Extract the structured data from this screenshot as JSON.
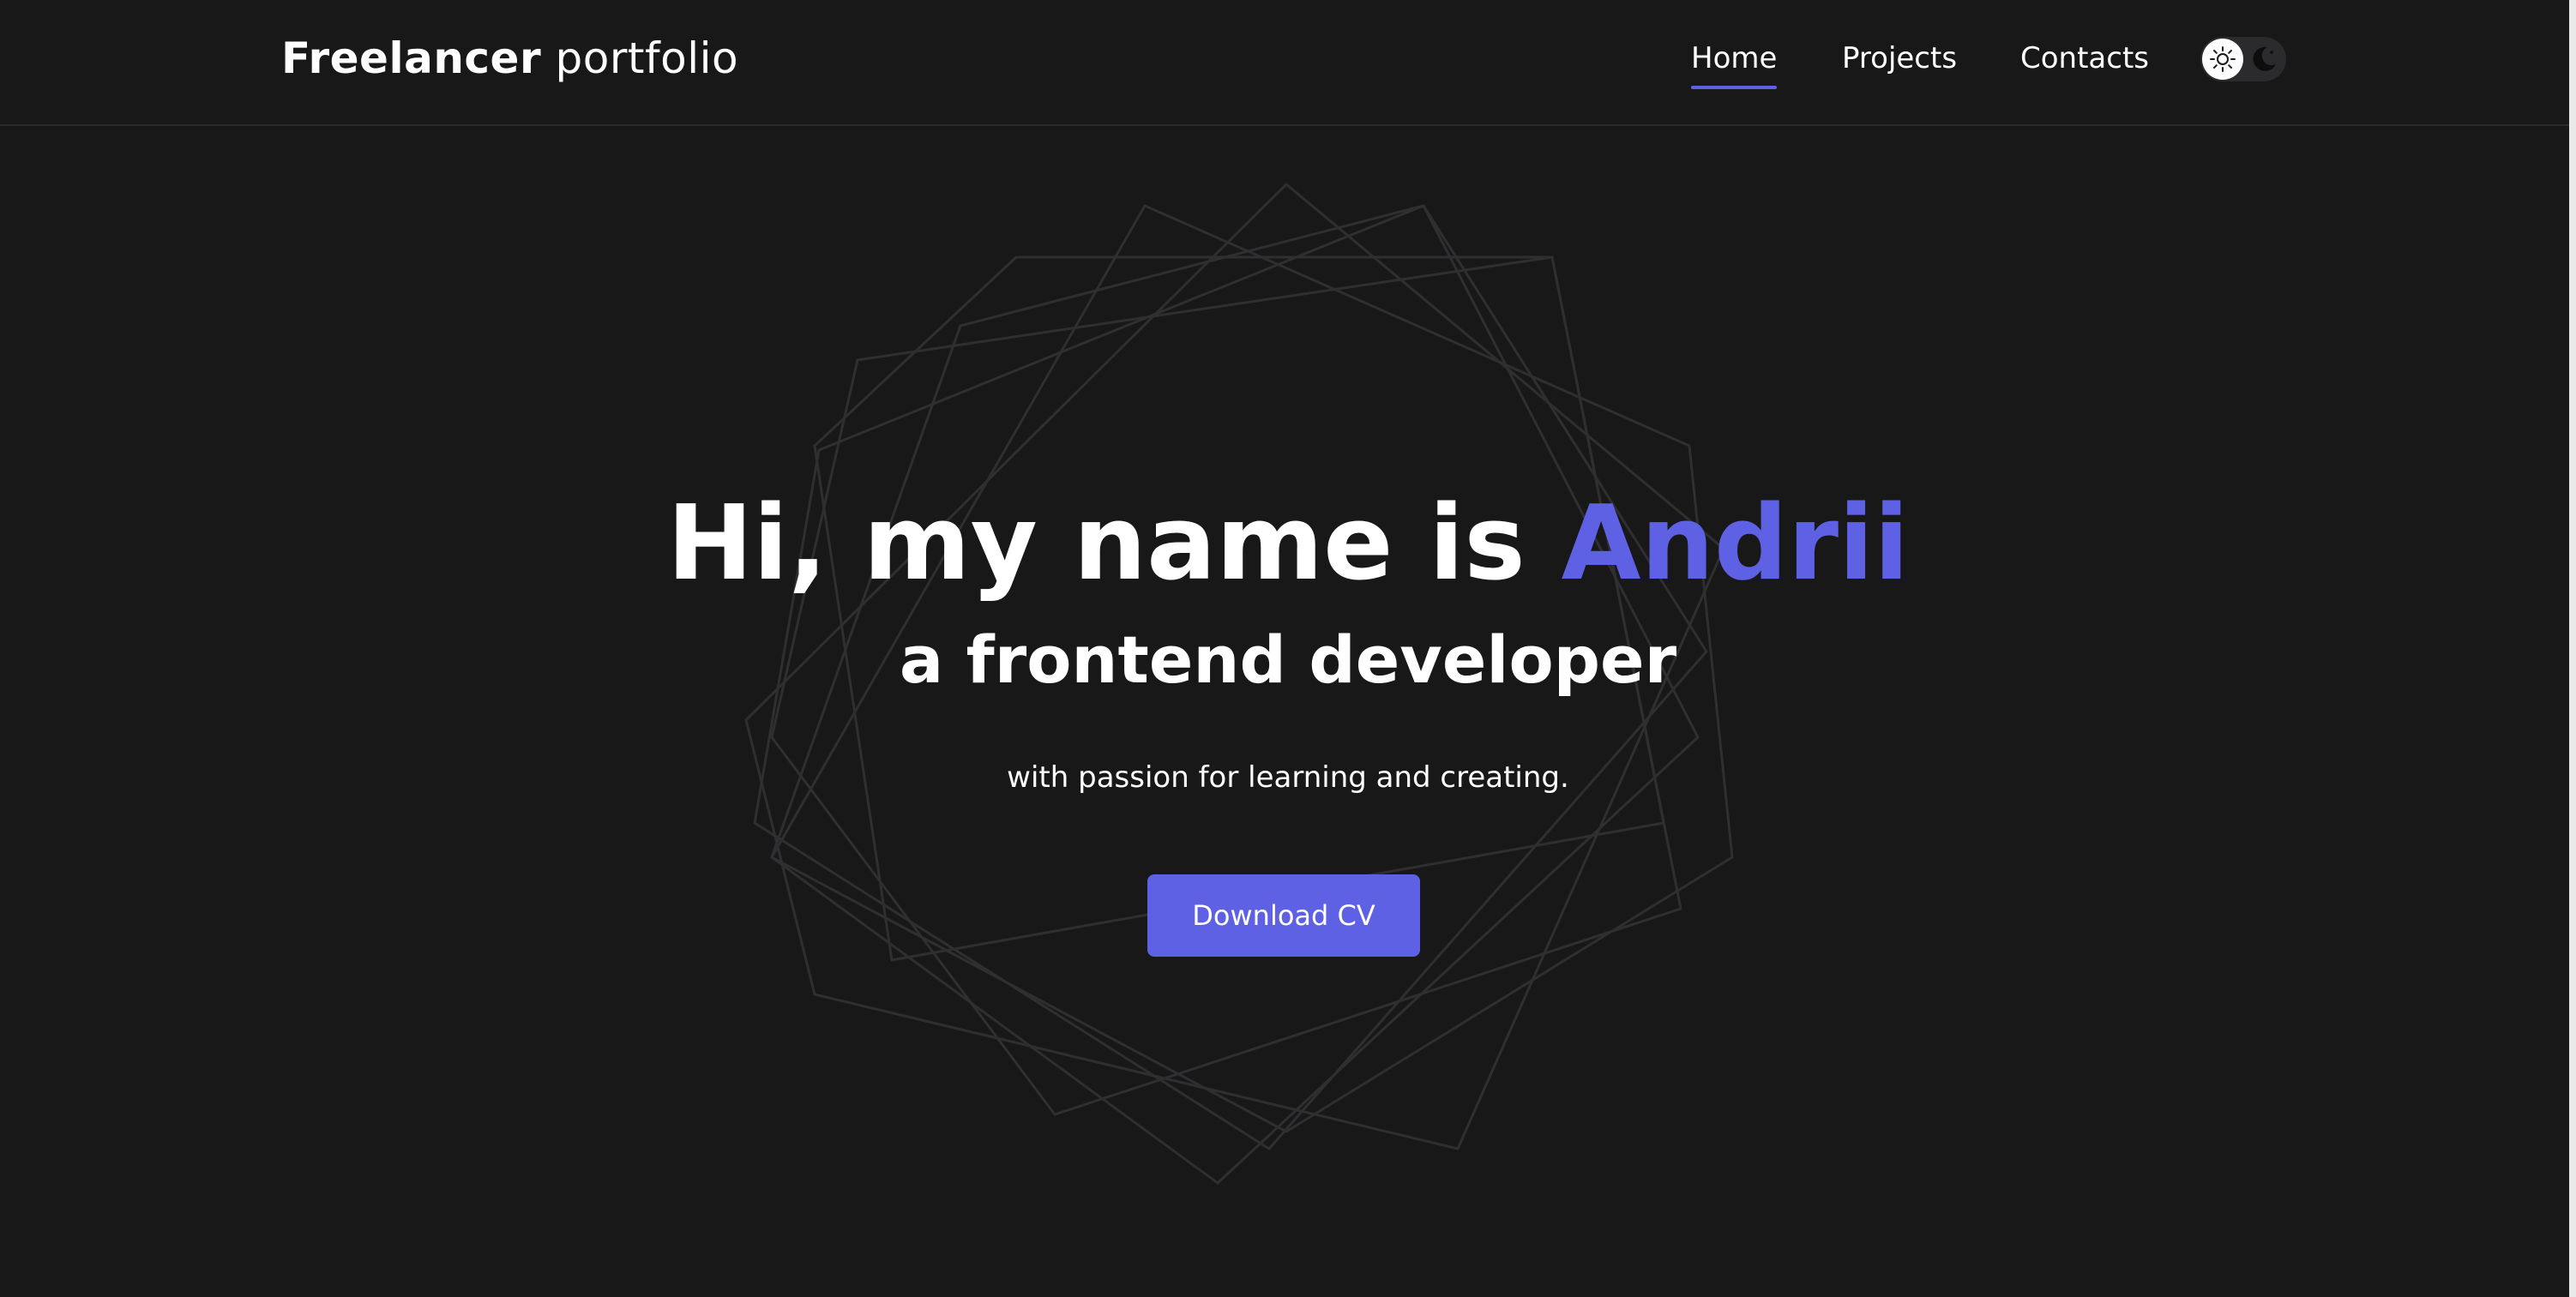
{
  "header": {
    "logo_strong": "Freelancer",
    "logo_light": "portfolio",
    "nav": [
      {
        "label": "Home",
        "active": true
      },
      {
        "label": "Projects",
        "active": false
      },
      {
        "label": "Contacts",
        "active": false
      }
    ],
    "theme_toggle": {
      "light_icon": "sun-icon",
      "dark_icon": "moon-icon",
      "selected": "light"
    }
  },
  "hero": {
    "title_prefix": "Hi, my name is",
    "title_name": "Andrii",
    "subtitle": "a frontend developer",
    "tagline": "with passion for learning and creating.",
    "cta_label": "Download CV"
  },
  "colors": {
    "background": "#181819",
    "accent": "#5e61e3",
    "text": "#ffffff",
    "decoration_stroke": "#2f2f31"
  }
}
